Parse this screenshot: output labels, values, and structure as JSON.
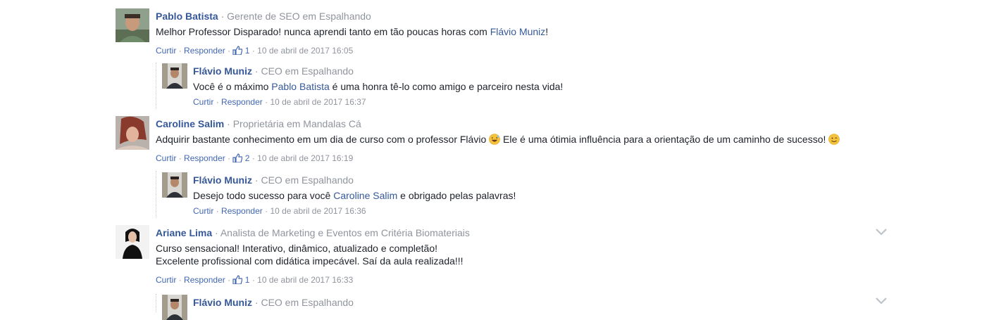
{
  "comments": [
    {
      "author": "Pablo Batista",
      "role": "Gerente de SEO em Espalhando",
      "text_before": "Melhor Professor Disparado! nunca aprendi tanto em tão poucas horas com ",
      "mention": "Flávio Muniz",
      "text_after": "!",
      "like_label": "Curtir",
      "reply_label": "Responder",
      "likes": "1",
      "timestamp": "10 de abril de 2017 16:05",
      "reply": {
        "author": "Flávio Muniz",
        "role": "CEO em Espalhando",
        "text_before": "Você é o máximo ",
        "mention": "Pablo Batista",
        "text_after": " é uma honra tê-lo como amigo e parceiro nesta vida!",
        "like_label": "Curtir",
        "reply_label": "Responder",
        "timestamp": "10 de abril de 2017 16:37"
      }
    },
    {
      "author": "Caroline Salim",
      "role": "Proprietária em Mandalas Cá",
      "text_before": "Adquirir bastante conhecimento em um dia de curso com o professor Flávio ",
      "text_after": " Ele é uma ótimia influência para a orientação de um caminho de sucesso! ",
      "like_label": "Curtir",
      "reply_label": "Responder",
      "likes": "2",
      "timestamp": "10 de abril de 2017 16:19",
      "reply": {
        "author": "Flávio Muniz",
        "role": "CEO em Espalhando",
        "text_before": "Desejo todo sucesso para você ",
        "mention": "Caroline Salim",
        "text_after": " e obrigado pelas palavras!",
        "like_label": "Curtir",
        "reply_label": "Responder",
        "timestamp": "10 de abril de 2017 16:36"
      }
    },
    {
      "author": "Ariane Lima",
      "role": "Analista de Marketing e Eventos em Critéria Biomateriais",
      "line1": "Curso sensacional! Interativo, dinâmico, atualizado e completão!",
      "line2": "Excelente profissional com didática impecável. Saí da aula realizada!!!",
      "like_label": "Curtir",
      "reply_label": "Responder",
      "likes": "1",
      "timestamp": "10 de abril de 2017 16:33",
      "reply": {
        "author": "Flávio Muniz",
        "role": "CEO em Espalhando"
      }
    }
  ],
  "separator": "·",
  "icons": {
    "like": "thumbs-up-icon",
    "menu": "chevron-down-icon",
    "emoji_laugh": "grinning-sweat-emoji-icon",
    "emoji_wink": "winking-face-emoji-icon"
  },
  "colors": {
    "link": "#365899",
    "meta": "#90949c",
    "action": "#4267b2"
  }
}
